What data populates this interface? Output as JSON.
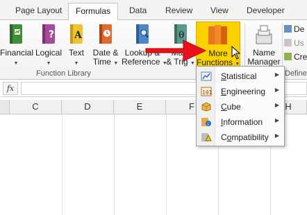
{
  "tabs": [
    {
      "label": "Page Layout",
      "active": false
    },
    {
      "label": "Formulas",
      "active": true
    },
    {
      "label": "Data",
      "active": false
    },
    {
      "label": "Review",
      "active": false
    },
    {
      "label": "View",
      "active": false
    },
    {
      "label": "Developer",
      "active": false
    }
  ],
  "ribbon": {
    "buttons": [
      {
        "line1": "Financial",
        "line2": "",
        "icon": "book-financial-icon"
      },
      {
        "line1": "Logical",
        "line2": "",
        "icon": "book-logical-icon"
      },
      {
        "line1": "Text",
        "line2": "",
        "icon": "book-text-icon"
      },
      {
        "line1": "Date &",
        "line2": "Time",
        "icon": "book-date-time-icon"
      },
      {
        "line1": "Lookup &",
        "line2": "Reference",
        "icon": "book-lookup-icon"
      },
      {
        "line1": "Math",
        "line2": "& Trig",
        "icon": "book-math-icon"
      },
      {
        "line1": "More",
        "line2": "Functions",
        "icon": "more-functions-books-icon"
      },
      {
        "line1": "Name",
        "line2": "Manager",
        "icon": "name-manager-icon"
      }
    ],
    "group_label": "Function Library",
    "group_label_right": "Define",
    "side_items": [
      "De",
      "Us",
      "Cre"
    ]
  },
  "formula_bar": {
    "fx_label": "fx",
    "value": ""
  },
  "columns": [
    "C",
    "D",
    "E",
    "F",
    "H"
  ],
  "menu": {
    "items": [
      {
        "accel": "S",
        "rest": "tatistical",
        "icon": "statistical-icon"
      },
      {
        "accel": "E",
        "rest": "ngineering",
        "icon": "engineering-icon"
      },
      {
        "accel": "C",
        "rest": "ube",
        "icon": "cube-icon"
      },
      {
        "accel": "I",
        "rest": "nformation",
        "icon": "information-icon"
      },
      {
        "accel": "",
        "rest": "ompatibility",
        "prefix": "C",
        "icon": "compatibility-icon"
      }
    ]
  },
  "colors": {
    "highlight": "#fbd200",
    "arrow": "#e8121a"
  }
}
